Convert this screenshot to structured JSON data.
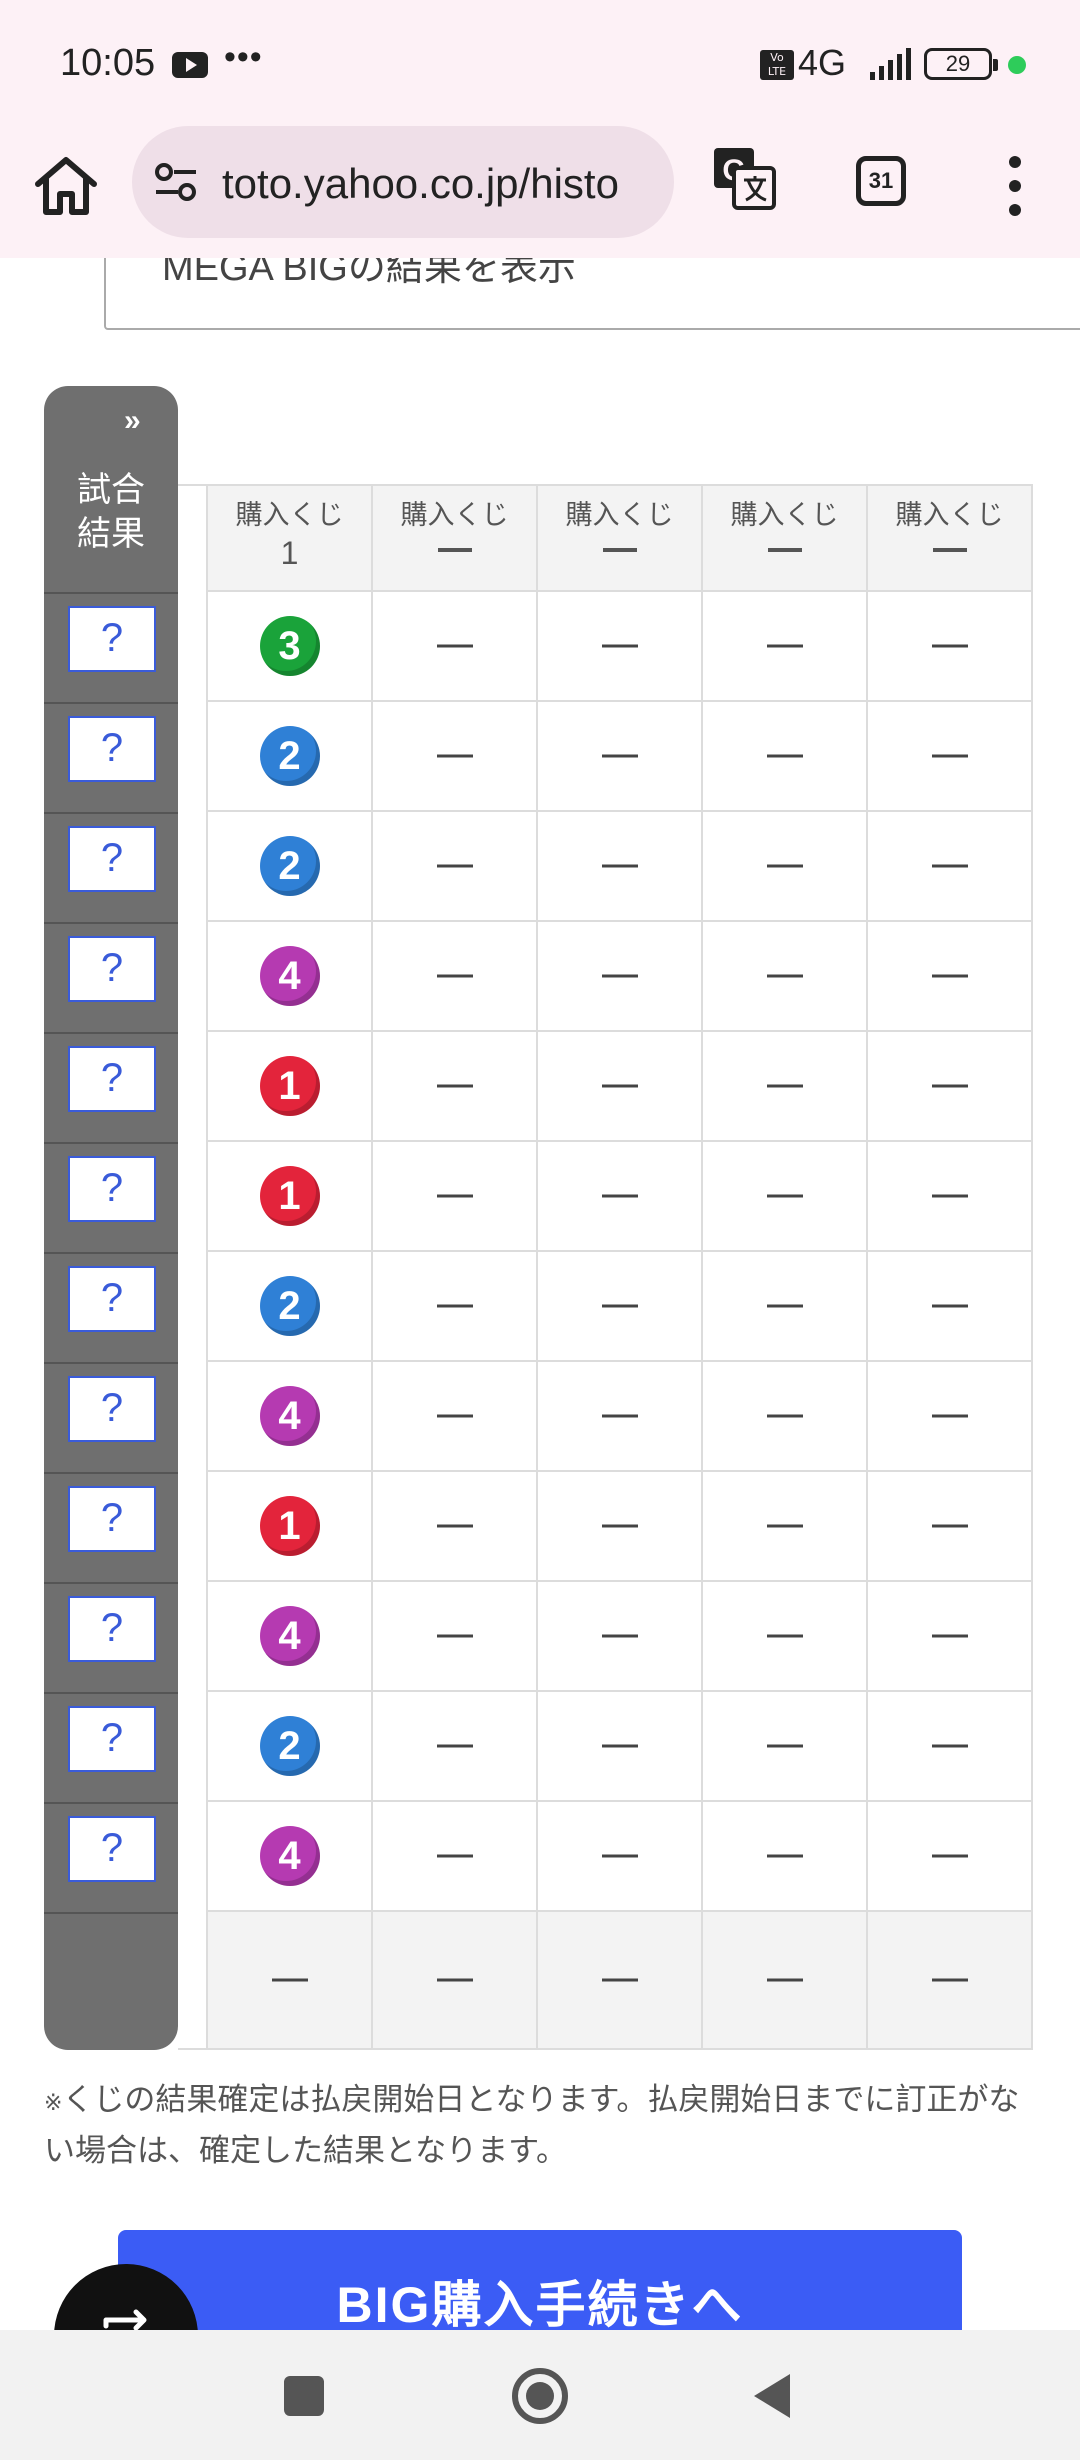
{
  "status": {
    "time": "10:05",
    "dots": "•••",
    "volte": "Vo LTE",
    "network": "4G",
    "battery": "29"
  },
  "browser": {
    "url": "toto.yahoo.co.jp/histo",
    "tabs_count": "31"
  },
  "select": {
    "label": "MEGA BIGの結果を表示"
  },
  "side": {
    "arrows": "»",
    "header": "試合結果",
    "q": "?"
  },
  "table": {
    "headers": [
      {
        "label": "購入くじ",
        "value": "1"
      },
      {
        "label": "購入くじ",
        "value": "—"
      },
      {
        "label": "購入くじ",
        "value": "—"
      },
      {
        "label": "購入くじ",
        "value": "—"
      },
      {
        "label": "購入くじ",
        "value": "—"
      }
    ],
    "picks": [
      "3",
      "2",
      "2",
      "4",
      "1",
      "1",
      "2",
      "4",
      "1",
      "4",
      "2",
      "4"
    ],
    "footer": [
      "—",
      "—",
      "—",
      "—",
      "—"
    ]
  },
  "note": {
    "mark": "※",
    "text": "くじの結果確定は払戻開始日となります。払戻開始日までに訂正がない場合は、確定した結果となります。"
  },
  "cta": {
    "label": "BIG購入手続きへ"
  },
  "colors": {
    "pick1": "#e3243b",
    "pick2": "#2f80d6",
    "pick3": "#1aa33a",
    "pick4": "#b53ab1",
    "cta": "#3b5cf5",
    "side": "#6f6f6f"
  },
  "icons": [
    "home-icon",
    "site-settings-icon",
    "translate-icon",
    "tab-switcher-icon",
    "more-vert-icon",
    "chevron-down-icon",
    "double-chevron-right-icon",
    "swap-icon"
  ]
}
